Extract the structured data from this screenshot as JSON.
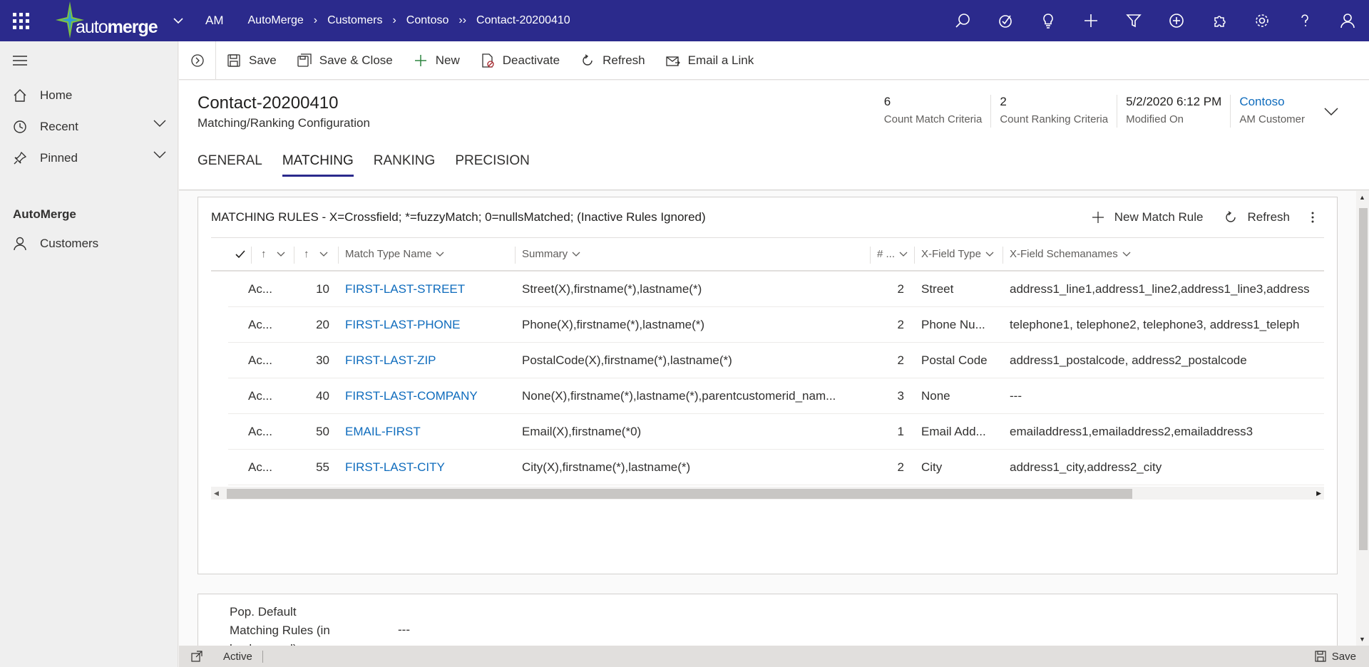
{
  "app": {
    "short": "AM",
    "logo_text_bold": "auto",
    "logo_text_rest": "merge",
    "breadcrumbs": [
      "AutoMerge",
      "Customers",
      "Contoso",
      "Contact-20200410"
    ],
    "top_icons": [
      "search-icon",
      "task-icon",
      "lightbulb-icon",
      "plus-icon",
      "filter-icon",
      "circle-plus-icon",
      "puzzle-icon",
      "gear-icon",
      "help-icon",
      "user-icon"
    ]
  },
  "sidebar": {
    "items": [
      {
        "label": "Home",
        "icon": "home-icon"
      },
      {
        "label": "Recent",
        "icon": "clock-icon"
      },
      {
        "label": "Pinned",
        "icon": "pin-icon"
      }
    ],
    "group": "AutoMerge",
    "group_items": [
      {
        "label": "Customers",
        "icon": "person-icon"
      }
    ]
  },
  "toolbar": {
    "save": "Save",
    "save_close": "Save & Close",
    "new": "New",
    "deactivate": "Deactivate",
    "refresh": "Refresh",
    "email_link": "Email a Link"
  },
  "record": {
    "title": "Contact-20200410",
    "subtitle": "Matching/Ranking Configuration",
    "fields": [
      {
        "value": "6",
        "label": "Count Match Criteria"
      },
      {
        "value": "2",
        "label": "Count Ranking Criteria"
      },
      {
        "value": "5/2/2020 6:12 PM",
        "label": "Modified On"
      },
      {
        "value": "Contoso",
        "label": "AM Customer"
      }
    ],
    "tabs": [
      "GENERAL",
      "MATCHING",
      "RANKING",
      "PRECISION"
    ],
    "active_tab": "MATCHING"
  },
  "matching": {
    "title": "MATCHING RULES - X=Crossfield; *=fuzzyMatch; 0=nullsMatched; (Inactive Rules Ignored)",
    "new_rule": "New Match Rule",
    "refresh": "Refresh",
    "columns": {
      "match_type_name": "Match Type Name",
      "summary": "Summary",
      "count": "# ...",
      "xfield_type": "X-Field Type",
      "xfield_schemanames": "X-Field Schemanames"
    },
    "rows": [
      {
        "status": "Ac...",
        "order": "10",
        "name": "FIRST-LAST-STREET",
        "summary": "Street(X),firstname(*),lastname(*)",
        "count": "2",
        "xtype": "Street",
        "schemas": "address1_line1,address1_line2,address1_line3,address"
      },
      {
        "status": "Ac...",
        "order": "20",
        "name": "FIRST-LAST-PHONE",
        "summary": "Phone(X),firstname(*),lastname(*)",
        "count": "2",
        "xtype": "Phone Nu...",
        "schemas": "telephone1, telephone2, telephone3, address1_teleph"
      },
      {
        "status": "Ac...",
        "order": "30",
        "name": "FIRST-LAST-ZIP",
        "summary": "PostalCode(X),firstname(*),lastname(*)",
        "count": "2",
        "xtype": "Postal Code",
        "schemas": "address1_postalcode, address2_postalcode"
      },
      {
        "status": "Ac...",
        "order": "40",
        "name": "FIRST-LAST-COMPANY",
        "summary": "None(X),firstname(*),lastname(*),parentcustomerid_nam...",
        "count": "3",
        "xtype": "None",
        "schemas": "---"
      },
      {
        "status": "Ac...",
        "order": "50",
        "name": "EMAIL-FIRST",
        "summary": "Email(X),firstname(*0)",
        "count": "1",
        "xtype": "Email Add...",
        "schemas": "emailaddress1,emailaddress2,emailaddress3"
      },
      {
        "status": "Ac...",
        "order": "55",
        "name": "FIRST-LAST-CITY",
        "summary": "City(X),firstname(*),lastname(*)",
        "count": "2",
        "xtype": "City",
        "schemas": "address1_city,address2_city"
      }
    ]
  },
  "defaults": {
    "label": "Pop. Default Matching Rules (in background)",
    "value": "---"
  },
  "status_bar": {
    "status": "Active",
    "save": "Save"
  },
  "colors": {
    "topbar": "#2b2a8c",
    "link": "#0f6cbd"
  }
}
